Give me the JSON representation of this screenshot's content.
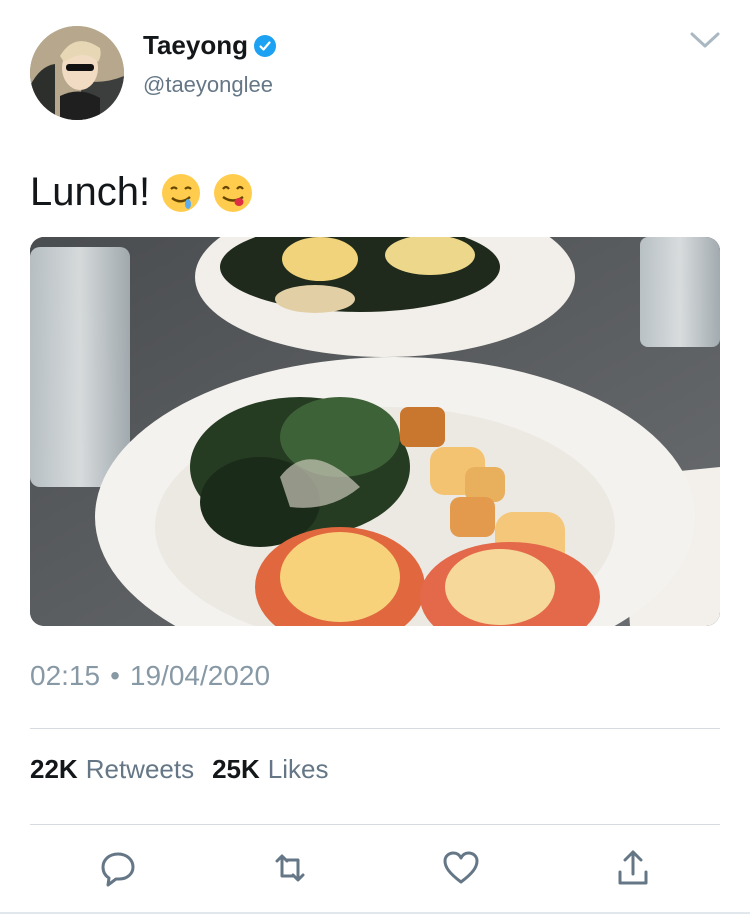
{
  "tweet": {
    "display_name": "Taeyong",
    "handle": "@taeyonglee",
    "text": "Lunch!",
    "emojis": [
      "drooling-face-icon",
      "face-savoring-food-icon"
    ],
    "timestamp_time": "02:15",
    "timestamp_separator": "•",
    "timestamp_date": "19/04/2020",
    "retweets_count": "22K",
    "retweets_label": "Retweets",
    "likes_count": "25K",
    "likes_label": "Likes"
  },
  "colors": {
    "verified": "#1da1f2",
    "secondary_text": "#657786",
    "timestamp_text": "#8899a6",
    "action_icon": "#657786",
    "divider": "#d5dbe0"
  },
  "icons": {
    "more": "chevron-down-icon",
    "reply": "reply-icon",
    "retweet": "retweet-icon",
    "like": "heart-icon",
    "share": "share-icon"
  }
}
